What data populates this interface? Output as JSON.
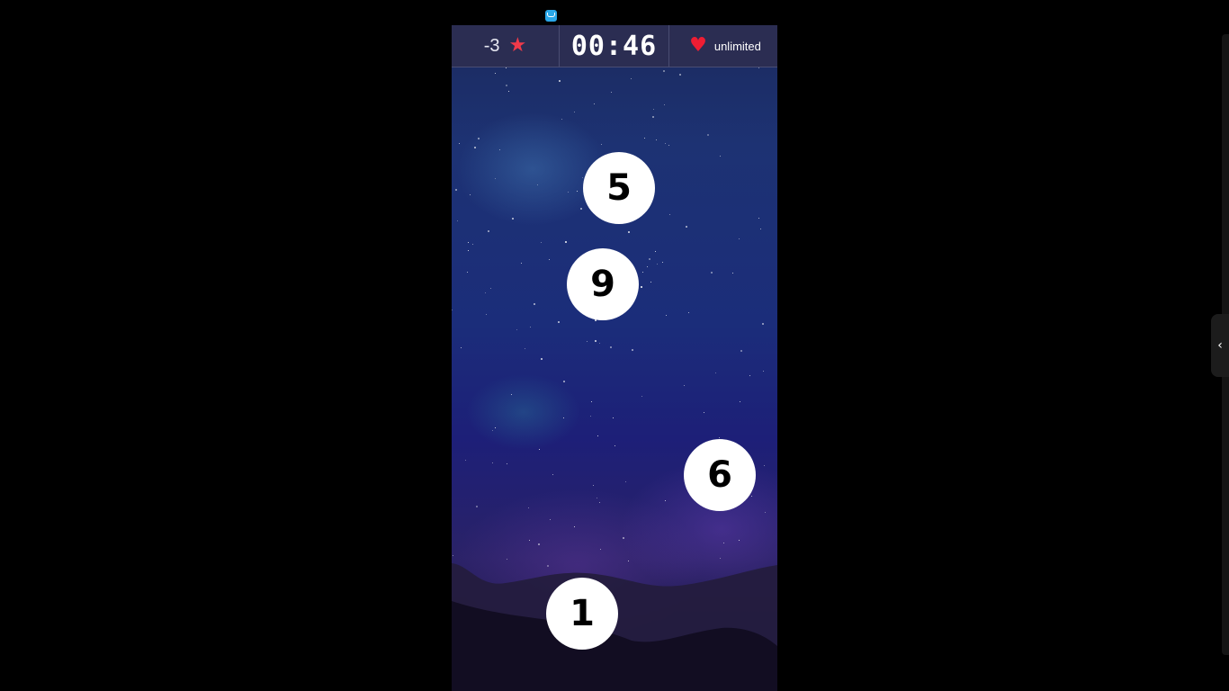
{
  "hud": {
    "score": "-3",
    "star_icon": "star-icon",
    "timer": "00:46",
    "heart_icon": "heart-icon",
    "lives": "unlimited"
  },
  "bubbles": [
    {
      "number": "5"
    },
    {
      "number": "9"
    },
    {
      "number": "6"
    },
    {
      "number": "1"
    }
  ],
  "side_tab": {
    "icon": "chevron-left-icon",
    "glyph": "‹"
  },
  "colors": {
    "star": "#f03a4a",
    "heart": "#ee1d33",
    "hud_bg": "#2b2d52"
  }
}
